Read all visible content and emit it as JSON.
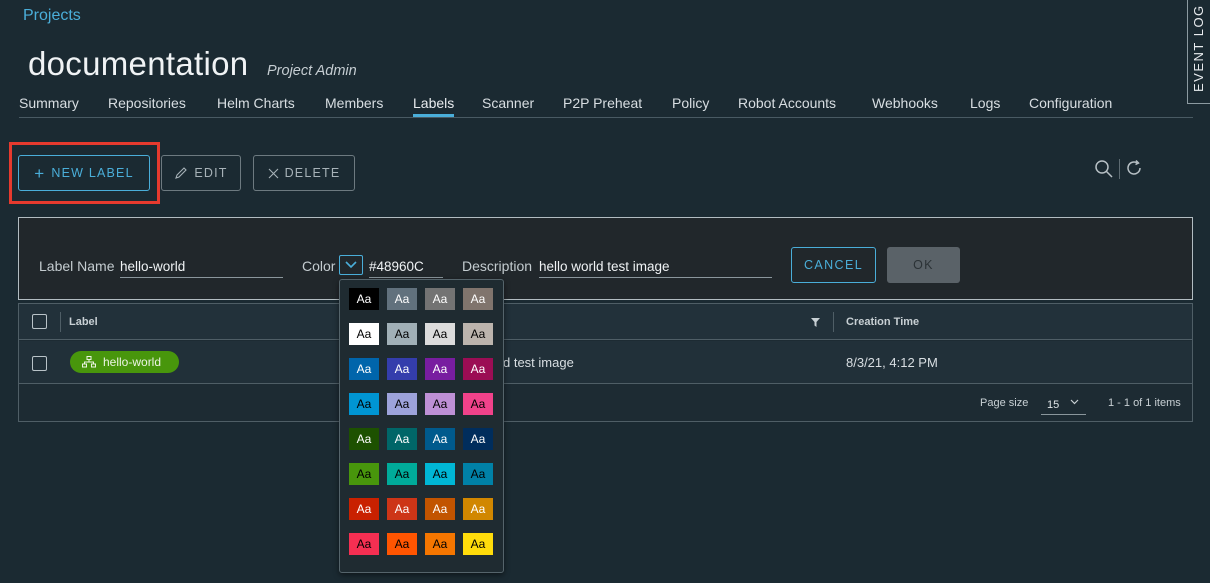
{
  "breadcrumb": "Projects",
  "project": {
    "name": "documentation",
    "role": "Project Admin"
  },
  "event_log": "EVENT LOG",
  "tabs": [
    "Summary",
    "Repositories",
    "Helm Charts",
    "Members",
    "Labels",
    "Scanner",
    "P2P Preheat",
    "Policy",
    "Robot Accounts",
    "Webhooks",
    "Logs",
    "Configuration"
  ],
  "active_tab": "Labels",
  "toolbar": {
    "new_label": "NEW LABEL",
    "edit": "EDIT",
    "delete": "DELETE"
  },
  "form": {
    "name_label": "Label Name",
    "name_value": "hello-world",
    "color_label": "Color",
    "color_value": "#48960C",
    "description_label": "Description",
    "description_value": "hello world test image",
    "cancel": "CANCEL",
    "ok": "OK"
  },
  "table": {
    "columns": [
      "Label",
      "Creation Time"
    ],
    "rows": [
      {
        "label": "hello-world",
        "description": "hello world test image",
        "created": "8/3/21, 4:12 PM"
      }
    ],
    "visible_description": "d test image",
    "page_size_label": "Page size",
    "page_size": "15",
    "range": "1 - 1 of 1 items"
  },
  "picker": {
    "sample": "Aa",
    "colors": [
      [
        "#000000",
        "#61717d",
        "#737373",
        "#80746d"
      ],
      [
        "#ffffff",
        "#a1b0b7",
        "#dcdcdc",
        "#bcb4ad"
      ],
      [
        "#0065ab",
        "#343dac",
        "#781da0",
        "#9b0d54"
      ],
      [
        "#0095d3",
        "#9da3db",
        "#be90d6",
        "#f1428a"
      ],
      [
        "#1d5100",
        "#006668",
        "#005a8d",
        "#002d5c"
      ],
      [
        "#48960c",
        "#00ab9a",
        "#00b7d6",
        "#0081a7"
      ],
      [
        "#c92100",
        "#cd3517",
        "#c25400",
        "#d18700"
      ],
      [
        "#f52f52",
        "#ff5501",
        "#f57600",
        "#ffdc0b"
      ]
    ],
    "text_colors": [
      [
        "#ffffff",
        "#ffffff",
        "#ffffff",
        "#ffffff"
      ],
      [
        "#000000",
        "#000000",
        "#000000",
        "#000000"
      ],
      [
        "#ffffff",
        "#ffffff",
        "#ffffff",
        "#ffffff"
      ],
      [
        "#000000",
        "#000000",
        "#000000",
        "#000000"
      ],
      [
        "#ffffff",
        "#ffffff",
        "#ffffff",
        "#ffffff"
      ],
      [
        "#000000",
        "#000000",
        "#000000",
        "#000000"
      ],
      [
        "#ffffff",
        "#ffffff",
        "#ffffff",
        "#ffffff"
      ],
      [
        "#000000",
        "#000000",
        "#000000",
        "#000000"
      ]
    ]
  }
}
